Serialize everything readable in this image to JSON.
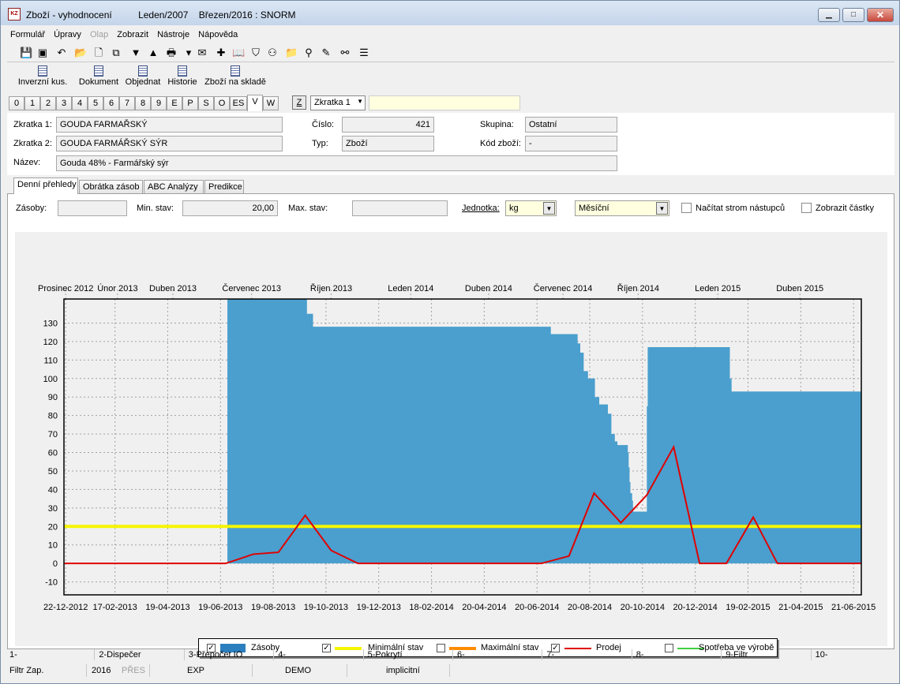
{
  "window": {
    "title": "Zboží - vyhodnocení          Leden/2007    Březen/2016 : SNORM",
    "minimize_glyph": "▁",
    "maximize_glyph": "□",
    "close_glyph": "✕"
  },
  "menu": [
    "Formulář",
    "Úpravy",
    "Olap",
    "Zobrazit",
    "Nástroje",
    "Nápověda"
  ],
  "toolbar_icons": [
    {
      "name": "save-icon",
      "glyph": "💾"
    },
    {
      "name": "save-as-icon",
      "glyph": "▣"
    },
    {
      "name": "undo-icon",
      "glyph": "↶"
    },
    {
      "name": "open-folder-icon",
      "glyph": "📂"
    },
    {
      "name": "new-document-icon",
      "glyph": "🗋"
    },
    {
      "name": "copy-icon",
      "glyph": "⧉"
    },
    {
      "name": "arrow-down-icon",
      "glyph": "▼"
    },
    {
      "name": "arrow-up-icon",
      "glyph": "▲"
    },
    {
      "name": "print-icon",
      "glyph": "🖶"
    },
    {
      "name": "dropdown-icon",
      "glyph": "▾"
    },
    {
      "name": "mail-icon",
      "glyph": "✉"
    },
    {
      "name": "excel-icon",
      "glyph": "✚"
    },
    {
      "name": "book-icon",
      "glyph": "📖"
    },
    {
      "name": "filter-icon",
      "glyph": "⛉"
    },
    {
      "name": "binoculars-icon",
      "glyph": "⚇"
    },
    {
      "name": "filter-folder-icon",
      "glyph": "📁"
    },
    {
      "name": "find-next-icon",
      "glyph": "⚲"
    },
    {
      "name": "filter-edit-icon",
      "glyph": "✎"
    },
    {
      "name": "find-all-icon",
      "glyph": "⚯"
    },
    {
      "name": "list-icon",
      "glyph": "☰"
    }
  ],
  "action_buttons": [
    "Inverzní kus.",
    "Dokument",
    "Objednat",
    "Historie",
    "Zboží na skladě"
  ],
  "number_tabs": [
    "0",
    "1",
    "2",
    "3",
    "4",
    "5",
    "6",
    "7",
    "8",
    "9",
    "E",
    "P",
    "S",
    "O",
    "ES",
    "V",
    "W"
  ],
  "active_number_tab": "V",
  "z_button": "Z",
  "zkratka_select": "Zkratka 1",
  "details": {
    "zkratka1_label": "Zkratka 1:",
    "zkratka1": "GOUDA FARMAŘSKÝ",
    "zkratka2_label": "Zkratka 2:",
    "zkratka2": "GOUDA FARMÁŘSKÝ SÝR",
    "nazev_label": "Název:",
    "nazev": "Gouda 48% - Farmářský sýr",
    "cislo_label": "Číslo:",
    "cislo": "421",
    "typ_label": "Typ:",
    "typ": "Zboží",
    "skupina_label": "Skupina:",
    "skupina": "Ostatní",
    "kod_label": "Kód zboží:",
    "kod": "-"
  },
  "sub_tabs": [
    "Denní přehledy",
    "Obrátka zásob",
    "ABC Analýzy",
    "Predikce"
  ],
  "filters": {
    "zasoby_label": "Zásoby:",
    "zasoby": "",
    "min_label": "Min. stav:",
    "min": "20,00",
    "max_label": "Max. stav:",
    "max": "",
    "jednotka_label": "Jednotka:",
    "jednotka": "kg",
    "period": "Měsíční",
    "nacitat_label": "Načítat strom nástupců",
    "zobrazit_label": "Zobrazit částky",
    "arrow": "▼"
  },
  "chart_data": {
    "type": "area",
    "top_labels": [
      "Prosinec 2012",
      "Únor 2013",
      "Duben 2013",
      "Červenec 2013",
      "Říjen 2013",
      "Leden 2014",
      "Duben 2014",
      "Červenec 2014",
      "Říjen 2014",
      "Leden 2015",
      "Duben 2015"
    ],
    "top_label_dates": [
      "2012-12-22",
      "2013-02-20",
      "2013-04-25",
      "2013-07-25",
      "2013-10-25",
      "2014-01-25",
      "2014-04-25",
      "2014-07-20",
      "2014-10-15",
      "2015-01-15",
      "2015-04-20"
    ],
    "x_ticks": [
      "22-12-2012",
      "17-02-2013",
      "19-04-2013",
      "19-06-2013",
      "19-08-2013",
      "19-10-2013",
      "19-12-2013",
      "18-02-2014",
      "20-04-2014",
      "20-06-2014",
      "20-08-2014",
      "20-10-2014",
      "20-12-2014",
      "19-02-2015",
      "21-04-2015",
      "21-06-2015"
    ],
    "xlim": [
      "2012-12-20",
      "2015-06-30"
    ],
    "y_ticks": [
      -10,
      0,
      10,
      20,
      30,
      40,
      50,
      60,
      70,
      80,
      90,
      100,
      110,
      120,
      130
    ],
    "ylim": [
      -17,
      143
    ],
    "grid": true,
    "legend_position": "bottom",
    "series": [
      {
        "name": "Zásoby",
        "kind": "step-area",
        "color": "#4a9fce",
        "visible": true,
        "points": [
          [
            "2012-12-20",
            0
          ],
          [
            "2013-06-26",
            0
          ],
          [
            "2013-06-27",
            143
          ],
          [
            "2013-09-26",
            143
          ],
          [
            "2013-09-27",
            135
          ],
          [
            "2013-10-03",
            135
          ],
          [
            "2013-10-04",
            128
          ],
          [
            "2014-07-05",
            128
          ],
          [
            "2014-07-06",
            124
          ],
          [
            "2014-08-05",
            124
          ],
          [
            "2014-08-06",
            119
          ],
          [
            "2014-08-09",
            114
          ],
          [
            "2014-08-13",
            104
          ],
          [
            "2014-08-18",
            100
          ],
          [
            "2014-08-26",
            90
          ],
          [
            "2014-08-31",
            86
          ],
          [
            "2014-09-10",
            81
          ],
          [
            "2014-09-14",
            70
          ],
          [
            "2014-09-18",
            66
          ],
          [
            "2014-09-21",
            64
          ],
          [
            "2014-10-03",
            60
          ],
          [
            "2014-10-04",
            52
          ],
          [
            "2014-10-05",
            44
          ],
          [
            "2014-10-06",
            38
          ],
          [
            "2014-10-08",
            34
          ],
          [
            "2014-10-09",
            28
          ],
          [
            "2014-10-24",
            28
          ],
          [
            "2014-10-25",
            85
          ],
          [
            "2014-10-26",
            117
          ],
          [
            "2015-01-28",
            117
          ],
          [
            "2015-01-29",
            100
          ],
          [
            "2015-01-31",
            93
          ],
          [
            "2015-06-30",
            93
          ]
        ]
      },
      {
        "name": "Minimální stav",
        "kind": "line",
        "color": "#f5f500",
        "visible": true,
        "points": [
          [
            "2012-12-20",
            20
          ],
          [
            "2015-06-30",
            20
          ]
        ]
      },
      {
        "name": "Maximální stav",
        "kind": "line",
        "color": "#ff8c00",
        "visible": false,
        "points": []
      },
      {
        "name": "Prodej",
        "kind": "line",
        "color": "#e00000",
        "visible": true,
        "points": [
          [
            "2012-12-20",
            0
          ],
          [
            "2013-06-25",
            0
          ],
          [
            "2013-07-27",
            5
          ],
          [
            "2013-08-25",
            6
          ],
          [
            "2013-09-25",
            26
          ],
          [
            "2013-10-25",
            7
          ],
          [
            "2013-11-25",
            0
          ],
          [
            "2014-06-25",
            0
          ],
          [
            "2014-07-27",
            4
          ],
          [
            "2014-08-25",
            38
          ],
          [
            "2014-09-25",
            22
          ],
          [
            "2014-10-25",
            37
          ],
          [
            "2014-11-25",
            63
          ],
          [
            "2014-12-25",
            0
          ],
          [
            "2015-01-25",
            0
          ],
          [
            "2015-02-25",
            25
          ],
          [
            "2015-03-25",
            0
          ],
          [
            "2015-06-30",
            0
          ]
        ]
      },
      {
        "name": "Spotřeba ve výrobě",
        "kind": "line",
        "color": "#40d040",
        "visible": false,
        "points": []
      }
    ]
  },
  "fkeys": [
    "1-",
    "2-Dispečer",
    "3-Přepočet IO",
    "4-",
    "5-Pokrytí",
    "6-",
    "7-",
    "8-",
    "9-Filtr",
    "10-"
  ],
  "status": {
    "filtr": "Filtr Zap.",
    "year": "2016",
    "pres": "PŘES",
    "exp": "EXP",
    "demo": "DEMO",
    "implicitni": "implicitní"
  },
  "checkmark": "✓"
}
